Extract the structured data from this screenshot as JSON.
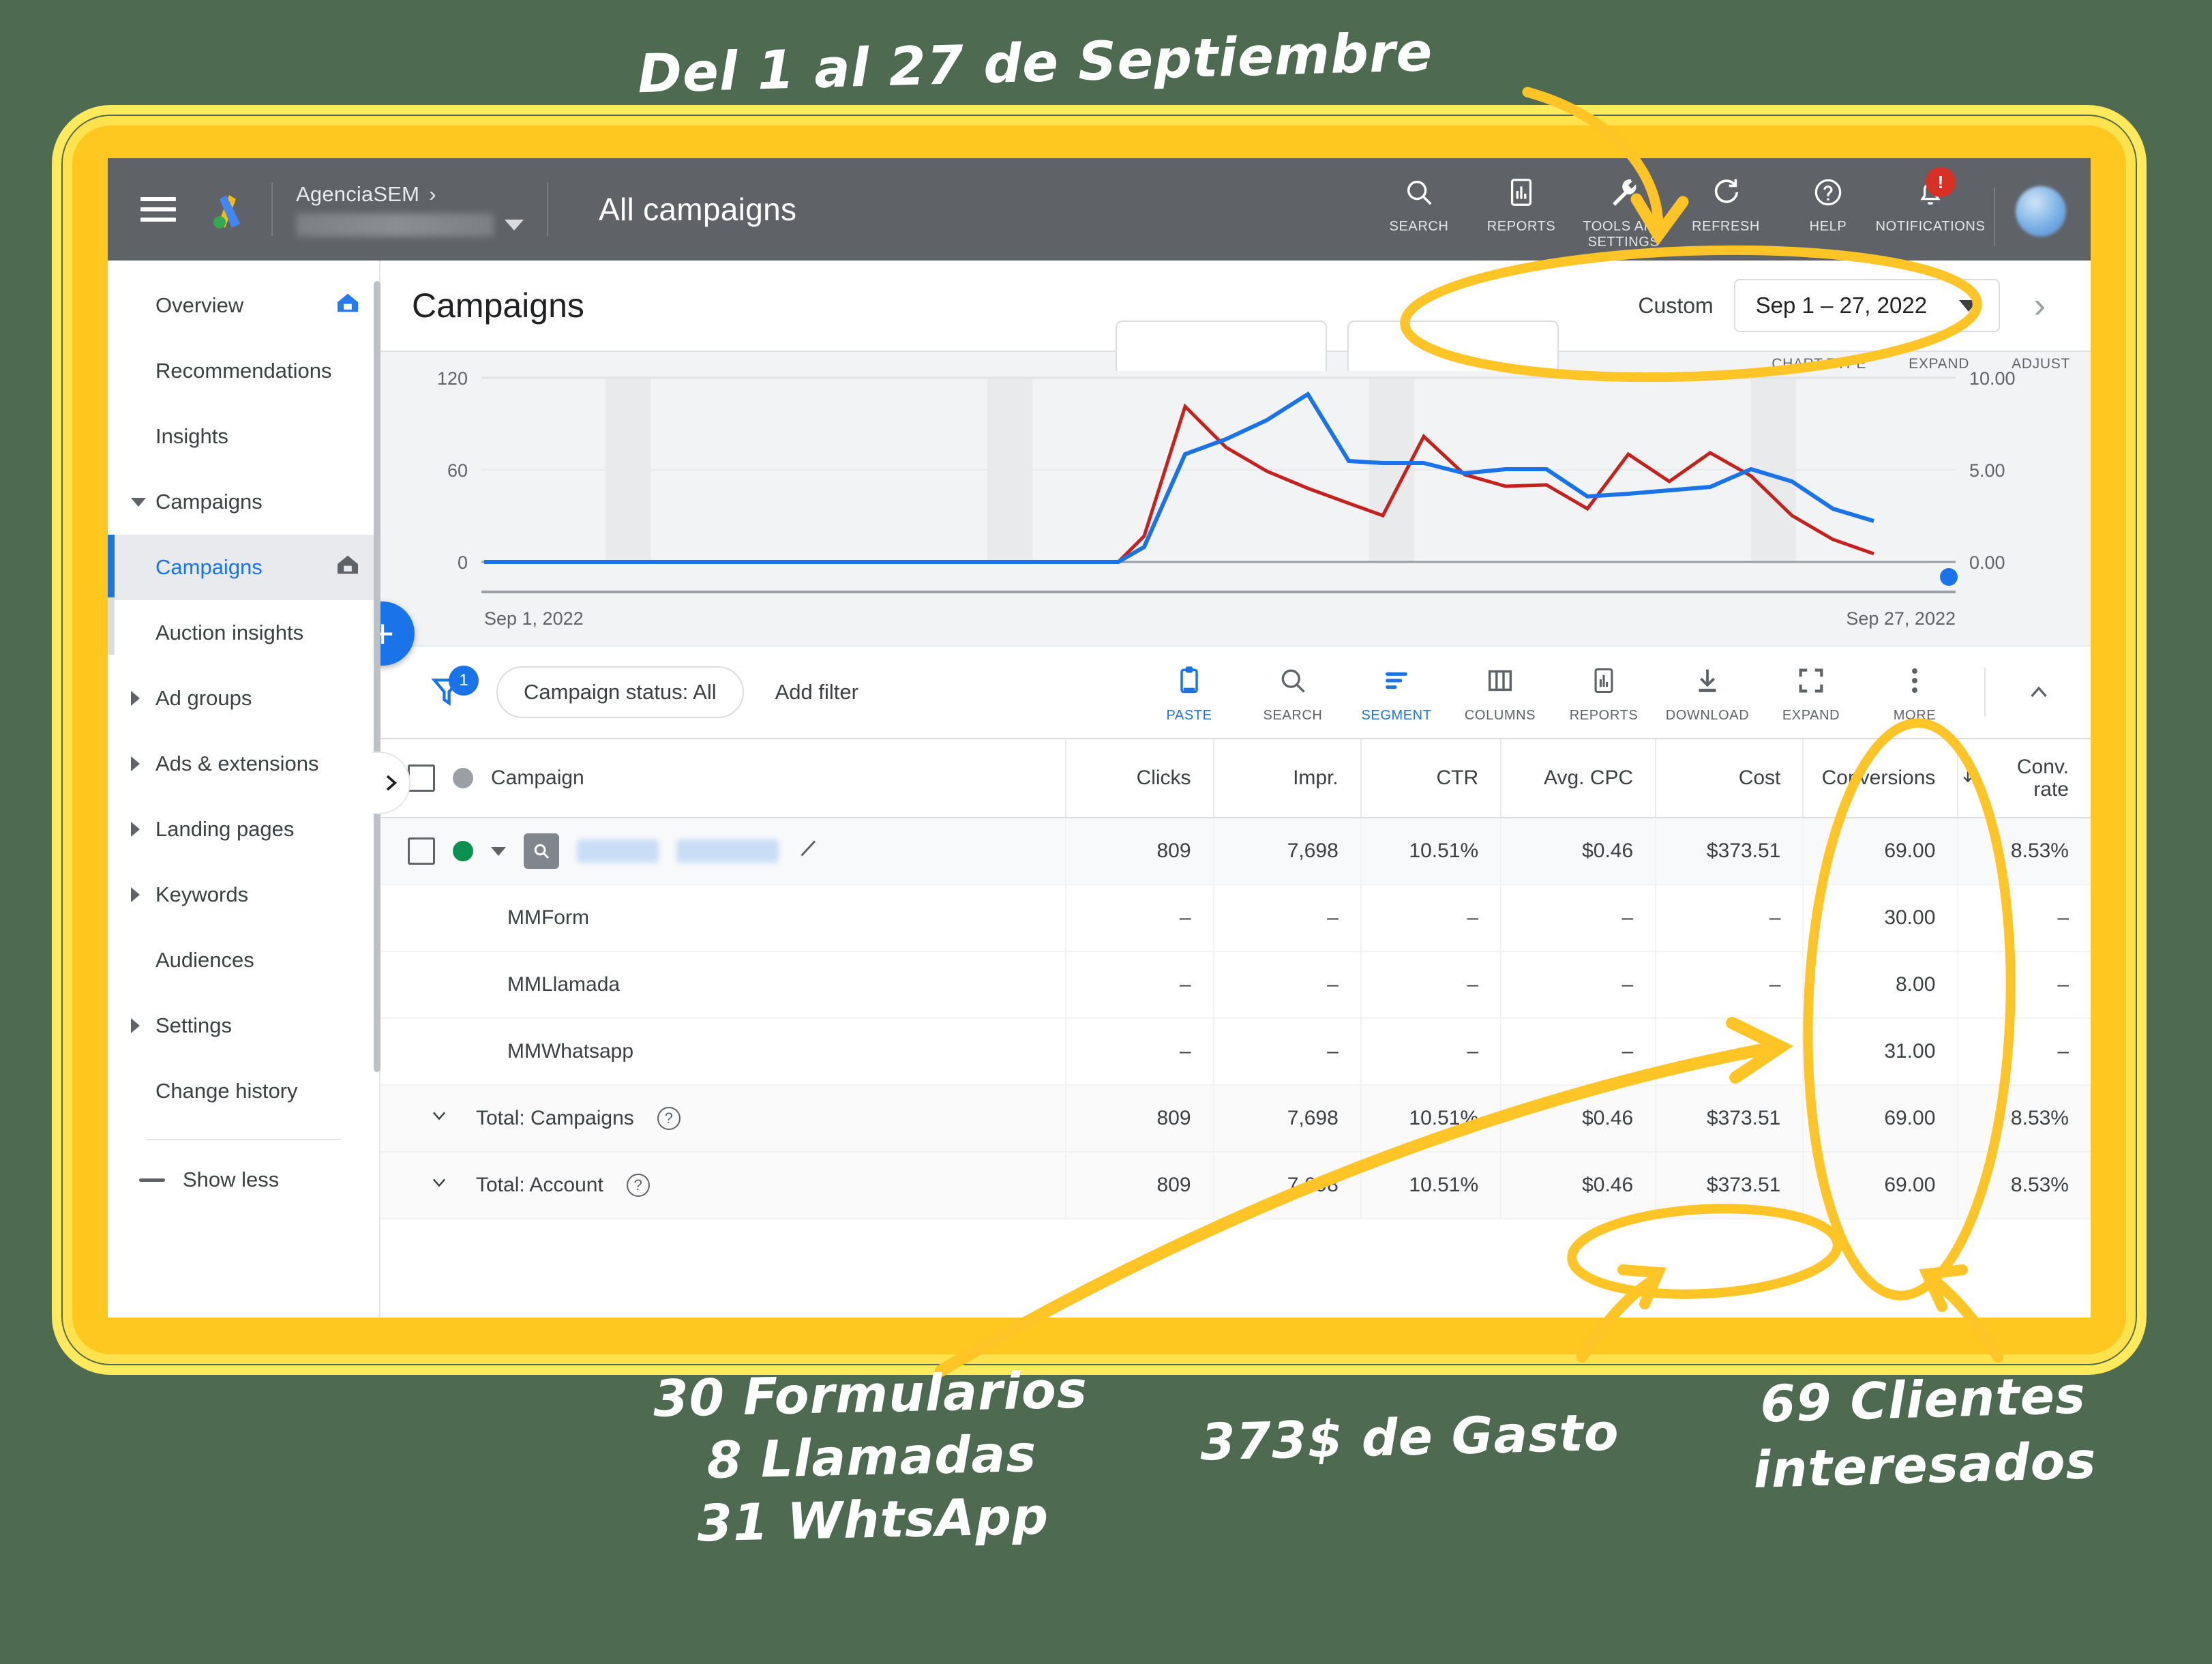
{
  "topbar": {
    "menu_icon": "hamburger-menu-icon",
    "logo_icon": "google-ads-logo",
    "account_name": "AgenciaSEM",
    "account_chevron": "›",
    "account_id_masked": "",
    "page_title": "All campaigns",
    "actions": [
      {
        "label": "SEARCH",
        "icon": "search-icon"
      },
      {
        "label": "REPORTS",
        "icon": "reports-icon"
      },
      {
        "label": "TOOLS AND SETTINGS",
        "icon": "wrench-icon"
      },
      {
        "label": "REFRESH",
        "icon": "refresh-icon"
      },
      {
        "label": "HELP",
        "icon": "help-icon"
      },
      {
        "label": "NOTIFICATIONS",
        "icon": "bell-icon",
        "badge": "!"
      }
    ],
    "avatar": "user-avatar"
  },
  "sidebar": {
    "items": [
      {
        "label": "Overview",
        "level": "top",
        "icon": "home-icon-blue",
        "expandable": false
      },
      {
        "label": "Recommendations",
        "level": "top",
        "expandable": false
      },
      {
        "label": "Insights",
        "level": "top",
        "expandable": false
      },
      {
        "label": "Campaigns",
        "level": "group",
        "expandable": true,
        "expanded": true
      },
      {
        "label": "Campaigns",
        "level": "sub",
        "active": true,
        "icon": "home-icon-grey"
      },
      {
        "label": "Auction insights",
        "level": "sub"
      },
      {
        "label": "Ad groups",
        "level": "top",
        "expandable": true
      },
      {
        "label": "Ads & extensions",
        "level": "top",
        "expandable": true
      },
      {
        "label": "Landing pages",
        "level": "top",
        "expandable": true
      },
      {
        "label": "Keywords",
        "level": "top",
        "expandable": true
      },
      {
        "label": "Audiences",
        "level": "top",
        "expandable": false
      },
      {
        "label": "Settings",
        "level": "top",
        "expandable": true
      },
      {
        "label": "Change history",
        "level": "top",
        "expandable": false
      }
    ],
    "show_less": "Show less",
    "drawer_handle_icon": "chevron-right-icon"
  },
  "main": {
    "page_title": "Campaigns",
    "date_range": {
      "preset_label": "Custom",
      "value": "Sep 1 – 27, 2022",
      "caret_icon": "chevron-down-icon",
      "next_icon": "chevron-right-icon"
    },
    "chart_tools": [
      "CHART TYPE",
      "EXPAND",
      "ADJUST"
    ],
    "fab_label": "+"
  },
  "chart_data": {
    "type": "line",
    "title": "",
    "xlabel": "",
    "ylabel": "",
    "x_start_label": "Sep 1, 2022",
    "x_end_label": "Sep 27, 2022",
    "left_axis": {
      "ticks": [
        "0",
        "60",
        "120"
      ],
      "ylim": [
        0,
        120
      ]
    },
    "right_axis": {
      "ticks": [
        "0.00",
        "5.00",
        "10.00"
      ],
      "ylim": [
        0,
        10
      ]
    },
    "grid": true,
    "legend": "none",
    "series": [
      {
        "name": "Clicks",
        "color": "#1a73e8",
        "axis": "left",
        "values": [
          0,
          0,
          0,
          0,
          0,
          0,
          0,
          0,
          0,
          0,
          0,
          0,
          0,
          0,
          0,
          0,
          16,
          72,
          85,
          108,
          118,
          62,
          62,
          60,
          48,
          52,
          53,
          32,
          36,
          39,
          42,
          49,
          41,
          26,
          20
        ]
      },
      {
        "name": "Cost",
        "color": "#c5221f",
        "axis": "right",
        "values": [
          0,
          0,
          0,
          0,
          0,
          0,
          0,
          0,
          0,
          0,
          0,
          0,
          0,
          0,
          0,
          0,
          14,
          64,
          102,
          75,
          58,
          45,
          35,
          68,
          52,
          48,
          38,
          30,
          55,
          42,
          58,
          50,
          30,
          14,
          10
        ]
      }
    ]
  },
  "filterbar": {
    "filter_icon": "funnel-icon",
    "filter_count": "1",
    "chip_label": "Campaign status: All",
    "add_filter": "Add filter",
    "tools": [
      {
        "label": "PASTE",
        "icon": "clipboard-icon",
        "active": true
      },
      {
        "label": "SEARCH",
        "icon": "search-icon",
        "active": false
      },
      {
        "label": "SEGMENT",
        "icon": "segment-icon",
        "active": true
      },
      {
        "label": "COLUMNS",
        "icon": "columns-icon",
        "active": false
      },
      {
        "label": "REPORTS",
        "icon": "reports-icon",
        "active": false
      },
      {
        "label": "DOWNLOAD",
        "icon": "download-icon",
        "active": false
      },
      {
        "label": "EXPAND",
        "icon": "expand-icon",
        "active": false
      },
      {
        "label": "MORE",
        "icon": "more-vert-icon",
        "active": false
      }
    ],
    "collapse_icon": "chevron-up-icon"
  },
  "table": {
    "columns": [
      "Campaign",
      "Clicks",
      "Impr.",
      "CTR",
      "Avg. CPC",
      "Cost",
      "Conversions",
      "Conv. rate"
    ],
    "sort_column": "Conversions",
    "sort_icon": "arrow-down-icon",
    "rows": [
      {
        "type": "campaign",
        "status": "enabled",
        "name_masked": "",
        "icons": [
          "search-campaign-icon",
          "edit-pencil-icon"
        ],
        "clicks": "809",
        "impr": "7,698",
        "ctr": "10.51%",
        "avg_cpc": "$0.46",
        "cost": "$373.51",
        "conversions": "69.00",
        "conv_rate": "8.53%"
      },
      {
        "type": "segment",
        "name": "MMForm",
        "clicks": "–",
        "impr": "–",
        "ctr": "–",
        "avg_cpc": "–",
        "cost": "–",
        "conversions": "30.00",
        "conv_rate": "–"
      },
      {
        "type": "segment",
        "name": "MMLlamada",
        "clicks": "–",
        "impr": "–",
        "ctr": "–",
        "avg_cpc": "–",
        "cost": "–",
        "conversions": "8.00",
        "conv_rate": "–"
      },
      {
        "type": "segment",
        "name": "MMWhatsapp",
        "clicks": "–",
        "impr": "–",
        "ctr": "–",
        "avg_cpc": "–",
        "cost": "–",
        "conversions": "31.00",
        "conv_rate": "–"
      },
      {
        "type": "total",
        "name": "Total: Campaigns",
        "help": "?",
        "clicks": "809",
        "impr": "7,698",
        "ctr": "10.51%",
        "avg_cpc": "$0.46",
        "cost": "$373.51",
        "conversions": "69.00",
        "conv_rate": "8.53%"
      },
      {
        "type": "total",
        "name": "Total: Account",
        "help": "?",
        "clicks": "809",
        "impr": "7,698",
        "ctr": "10.51%",
        "avg_cpc": "$0.46",
        "cost": "$373.51",
        "conversions": "69.00",
        "conv_rate": "8.53%"
      }
    ]
  },
  "annotations": {
    "top": "Del 1 al 27  de Septiembre",
    "forms_line1": "30 Formularios",
    "forms_line2": "8 Llamadas",
    "forms_line3": "31 WhtsApp",
    "gasto": "373$ de Gasto",
    "clientes_line1": "69 Clientes",
    "clientes_line2": "interesados"
  },
  "colors": {
    "accent_yellow": "#ffc820",
    "frame_light": "#ffe24d",
    "background_green": "#4e6b51",
    "google_blue": "#1a73e8",
    "chart_red": "#c5221f",
    "topbar_grey": "#5f6368",
    "status_green": "#0d904f",
    "alert_red": "#d93025"
  }
}
